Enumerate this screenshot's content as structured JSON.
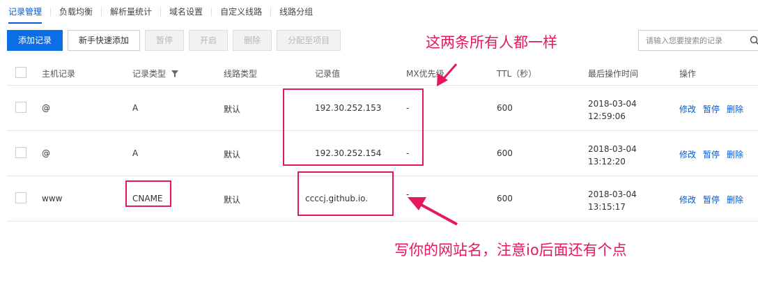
{
  "tabs": [
    "记录管理",
    "负载均衡",
    "解析量统计",
    "域名设置",
    "自定义线路",
    "线路分组"
  ],
  "active_tab": 0,
  "toolbar": {
    "add": "添加记录",
    "quick_add": "新手快速添加",
    "pause": "暂停",
    "enable": "开启",
    "delete": "删除",
    "assign": "分配至项目"
  },
  "search": {
    "placeholder": "请输入您要搜索的记录",
    "icon": "search-icon"
  },
  "columns": [
    "主机记录",
    "记录类型",
    "线路类型",
    "记录值",
    "MX优先级",
    "TTL（秒）",
    "最后操作时间",
    "操作"
  ],
  "records": [
    {
      "host": "@",
      "type": "A",
      "line": "默认",
      "value": "192.30.252.153",
      "mx": "-",
      "ttl": "600",
      "date": "2018-03-04",
      "time": "12:59:06"
    },
    {
      "host": "@",
      "type": "A",
      "line": "默认",
      "value": "192.30.252.154",
      "mx": "-",
      "ttl": "600",
      "date": "2018-03-04",
      "time": "13:12:20"
    },
    {
      "host": "www",
      "type": "CNAME",
      "line": "默认",
      "value": "ccccj.github.io.",
      "mx": "-",
      "ttl": "600",
      "date": "2018-03-04",
      "time": "13:15:17"
    }
  ],
  "actions": {
    "edit": "修改",
    "pause": "暂停",
    "delete": "删除"
  },
  "annotations": {
    "note_top": "这两条所有人都一样",
    "note_bottom": "写你的网站名，注意io后面还有个点",
    "color": "#e6175c"
  },
  "colors": {
    "primary": "#0a6ee6",
    "link": "#0059d6"
  }
}
